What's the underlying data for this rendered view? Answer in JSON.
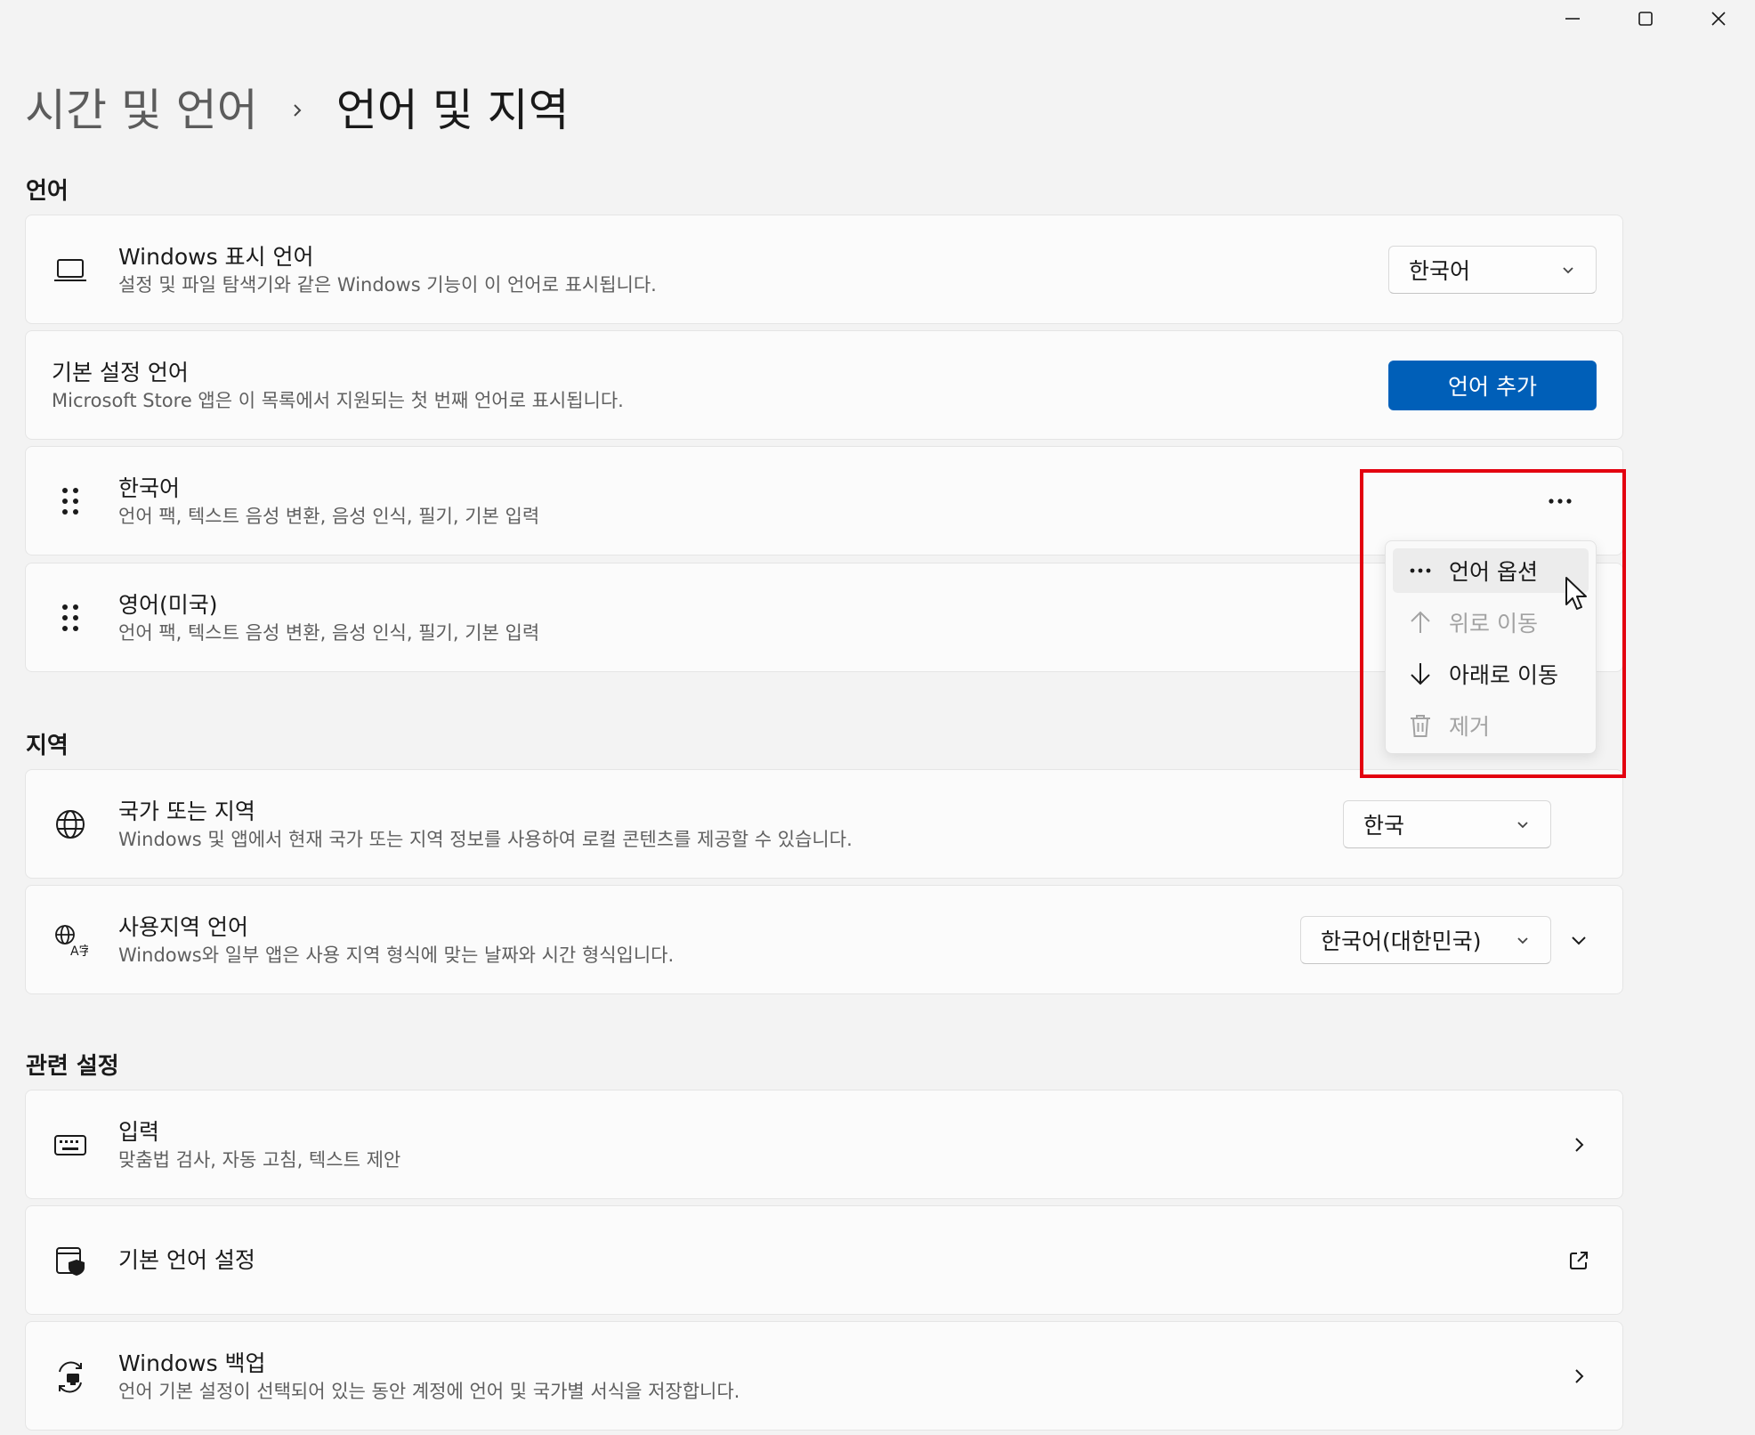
{
  "window": {
    "minimize_icon": "minimize-icon",
    "maximize_icon": "maximize-icon",
    "close_icon": "close-icon"
  },
  "breadcrumb": {
    "parent": "시간 및 언어",
    "current": "언어 및 지역"
  },
  "sections": {
    "language": "언어",
    "region": "지역",
    "related": "관련 설정"
  },
  "display_language": {
    "title": "Windows 표시 언어",
    "desc": "설정 및 파일 탐색기와 같은 Windows 기능이 이 언어로 표시됩니다.",
    "value": "한국어"
  },
  "preferred": {
    "title": "기본 설정 언어",
    "desc": "Microsoft Store 앱은 이 목록에서 지원되는 첫 번째 언어로 표시됩니다.",
    "add_button": "언어 추가"
  },
  "languages": [
    {
      "name": "한국어",
      "features": "언어 팩, 텍스트 음성 변환, 음성 인식, 필기, 기본 입력"
    },
    {
      "name": "영어(미국)",
      "features": "언어 팩, 텍스트 음성 변환, 음성 인식, 필기, 기본 입력"
    }
  ],
  "context_menu": {
    "items": [
      {
        "label": "언어 옵션",
        "icon": "more-icon",
        "enabled": true
      },
      {
        "label": "위로 이동",
        "icon": "arrow-up-icon",
        "enabled": false
      },
      {
        "label": "아래로 이동",
        "icon": "arrow-down-icon",
        "enabled": true
      },
      {
        "label": "제거",
        "icon": "trash-icon",
        "enabled": false
      }
    ]
  },
  "country": {
    "title": "국가 또는 지역",
    "desc": "Windows 및 앱에서 현재 국가 또는 지역 정보를 사용하여 로컬 콘텐츠를 제공할 수 있습니다.",
    "value": "한국"
  },
  "regional_format": {
    "title": "사용지역 언어",
    "desc": "Windows와 일부 앱은 사용 지역 형식에 맞는 날짜와 시간 형식입니다.",
    "value": "한국어(대한민국)"
  },
  "related": {
    "typing": {
      "title": "입력",
      "desc": "맞춤법 검사, 자동 고침, 텍스트 제안"
    },
    "admin": {
      "title": "기본 언어 설정"
    },
    "backup": {
      "title": "Windows 백업",
      "desc": "언어 기본 설정이 선택되어 있는 동안 계정에 언어 및 국가별 서식을 저장합니다."
    }
  },
  "colors": {
    "accent": "#005fb8",
    "highlight": "#e3000f",
    "background": "#f3f3f3"
  }
}
